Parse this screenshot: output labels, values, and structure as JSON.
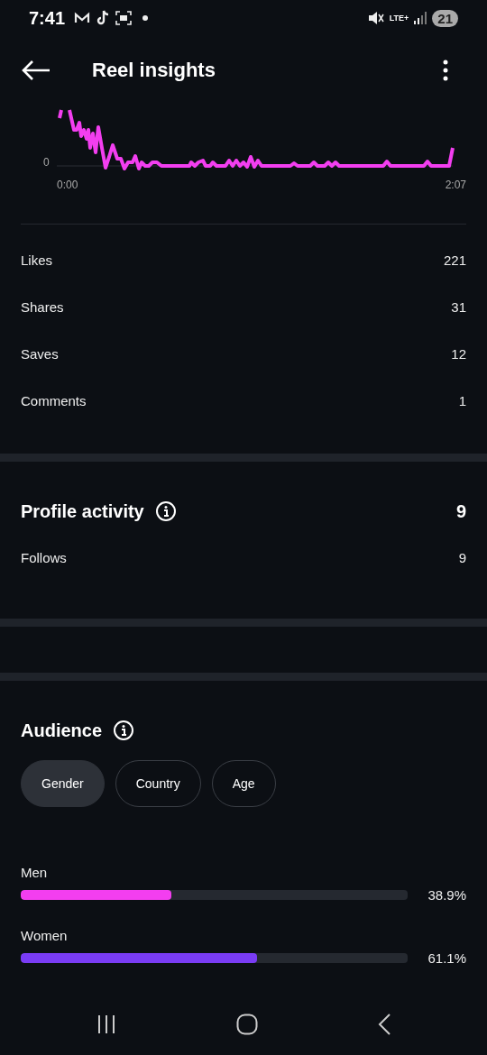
{
  "status_bar": {
    "time": "7:41",
    "network": "LTE+",
    "battery": "21"
  },
  "header": {
    "title": "Reel insights"
  },
  "retention_chart": {
    "y_label": "0",
    "x_start": "0:00",
    "x_end": "2:07"
  },
  "interactions": [
    {
      "label": "Likes",
      "value": "221"
    },
    {
      "label": "Shares",
      "value": "31"
    },
    {
      "label": "Saves",
      "value": "12"
    },
    {
      "label": "Comments",
      "value": "1"
    }
  ],
  "profile_activity": {
    "title": "Profile activity",
    "total": "9",
    "rows": [
      {
        "label": "Follows",
        "value": "9"
      }
    ]
  },
  "audience": {
    "title": "Audience",
    "tabs": [
      {
        "label": "Gender",
        "selected": true
      },
      {
        "label": "Country",
        "selected": false
      },
      {
        "label": "Age",
        "selected": false
      }
    ],
    "bars": [
      {
        "label": "Men",
        "level": 0.389,
        "reading": "38.9%",
        "color": "#f33ef0"
      },
      {
        "label": "Women",
        "level": 0.611,
        "reading": "61.1%",
        "color": "#7a3cf5"
      }
    ]
  }
}
